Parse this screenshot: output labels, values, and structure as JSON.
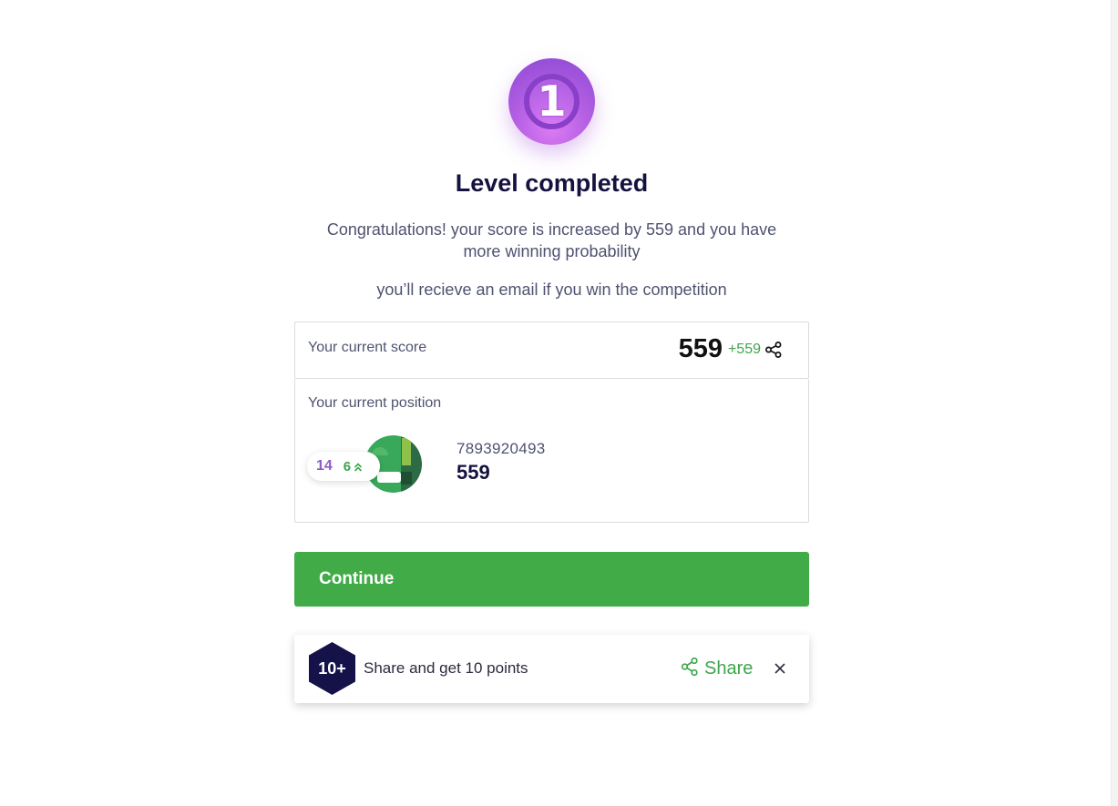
{
  "medal": {
    "level": "1"
  },
  "title": "Level completed",
  "subtitle": "Congratulations! your score is increased by 559 and you have more winning probability",
  "note": "you’ll recieve an email if you win the competition",
  "score": {
    "label": "Your current score",
    "value": "559",
    "delta": "+559",
    "share_icon": "share-icon"
  },
  "position": {
    "label": "Your current position",
    "rank": "14",
    "rank_change": "6",
    "rank_change_icon": "double-chevron-up-icon",
    "player_id": "7893920493",
    "player_score": "559"
  },
  "continue_label": "Continue",
  "share_bar": {
    "badge": "10+",
    "text": "Share and get 10 points",
    "share_label": "Share",
    "close_icon": "close-icon"
  },
  "colors": {
    "accent_green": "#41ab48",
    "title_navy": "#14123f",
    "medal_purple": "#b35fe3",
    "rank_purple": "#8b5cc4"
  }
}
